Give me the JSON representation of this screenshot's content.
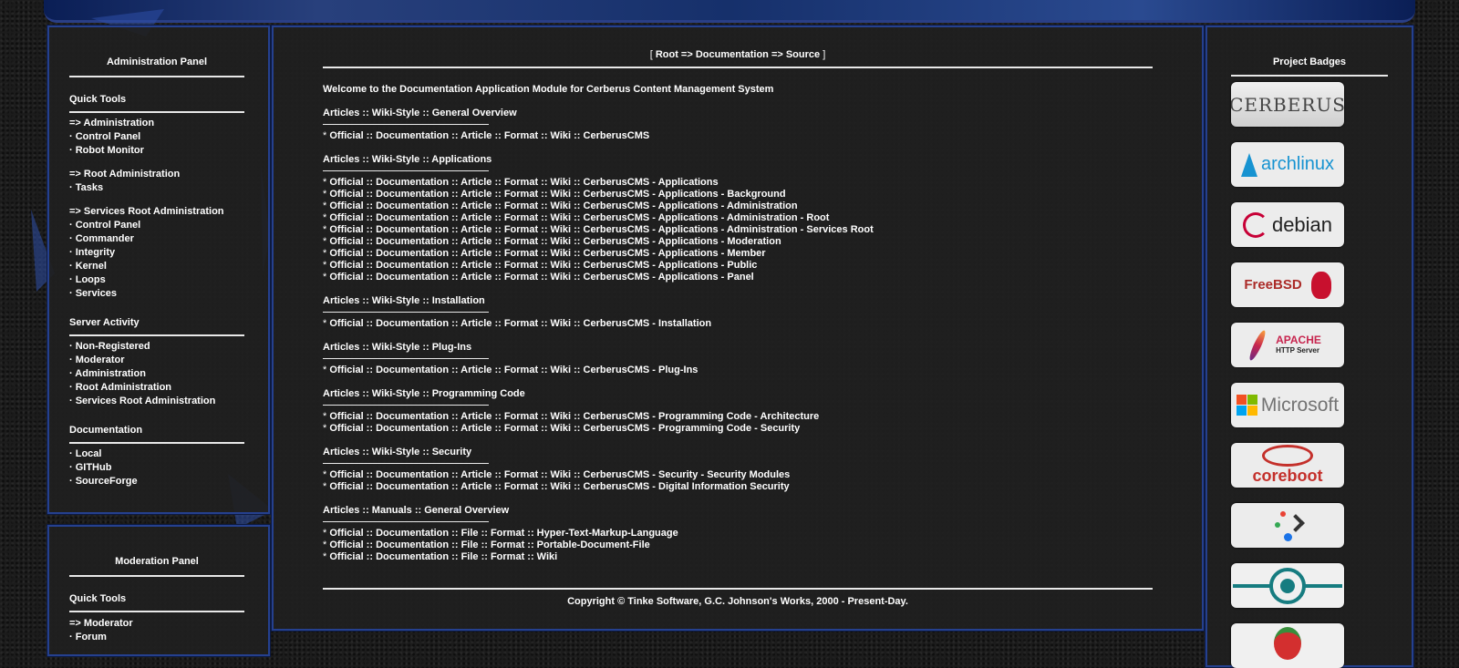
{
  "admin_panel": {
    "title": "Administration Panel",
    "sections": [
      {
        "header": "Quick Tools",
        "items": [
          "=> Administration",
          "· Control Panel",
          "· Robot Monitor",
          "",
          "=> Root Administration",
          "· Tasks",
          "",
          "=> Services Root Administration",
          "· Control Panel",
          "· Commander",
          "· Integrity",
          "· Kernel",
          "· Loops",
          "· Services"
        ]
      },
      {
        "header": "Server Activity",
        "items": [
          "· Non-Registered",
          "· Moderator",
          "· Administration",
          "· Root Administration",
          "· Services Root Administration"
        ]
      },
      {
        "header": "Documentation",
        "items": [
          "· Local",
          "· GITHub",
          "· SourceForge"
        ]
      }
    ]
  },
  "moderation_panel": {
    "title": "Moderation Panel",
    "header": "Quick Tools",
    "items": [
      "=> Moderator",
      "· Forum"
    ]
  },
  "main": {
    "breadcrumb": {
      "open": "[ ",
      "path": "Root => Documentation => Source",
      "close": " ]"
    },
    "welcome": "Welcome to the Documentation Application Module for Cerberus Content Management System",
    "sections": [
      {
        "header": "Articles :: Wiki-Style :: General Overview",
        "items": [
          "Official :: Documentation :: Article :: Format :: Wiki :: CerberusCMS"
        ]
      },
      {
        "header": "Articles :: Wiki-Style :: Applications",
        "items": [
          "Official :: Documentation :: Article :: Format :: Wiki :: CerberusCMS - Applications",
          "Official :: Documentation :: Article :: Format :: Wiki :: CerberusCMS - Applications - Background",
          "Official :: Documentation :: Article :: Format :: Wiki :: CerberusCMS - Applications - Administration",
          "Official :: Documentation :: Article :: Format :: Wiki :: CerberusCMS - Applications - Administration - Root",
          "Official :: Documentation :: Article :: Format :: Wiki :: CerberusCMS - Applications - Administration - Services Root",
          "Official :: Documentation :: Article :: Format :: Wiki :: CerberusCMS - Applications - Moderation",
          "Official :: Documentation :: Article :: Format :: Wiki :: CerberusCMS - Applications - Member",
          "Official :: Documentation :: Article :: Format :: Wiki :: CerberusCMS - Applications - Public",
          "Official :: Documentation :: Article :: Format :: Wiki :: CerberusCMS - Applications - Panel"
        ]
      },
      {
        "header": "Articles :: Wiki-Style :: Installation",
        "items": [
          "Official :: Documentation :: Article :: Format :: Wiki :: CerberusCMS - Installation"
        ]
      },
      {
        "header": "Articles :: Wiki-Style :: Plug-Ins",
        "items": [
          "Official :: Documentation :: Article :: Format :: Wiki :: CerberusCMS - Plug-Ins"
        ]
      },
      {
        "header": "Articles :: Wiki-Style :: Programming Code",
        "items": [
          "Official :: Documentation :: Article :: Format :: Wiki :: CerberusCMS - Programming Code - Architecture",
          "Official :: Documentation :: Article :: Format :: Wiki :: CerberusCMS - Programming Code - Security"
        ]
      },
      {
        "header": "Articles :: Wiki-Style :: Security",
        "items": [
          "Official :: Documentation :: Article :: Format :: Wiki :: CerberusCMS - Security - Security Modules",
          "Official :: Documentation :: Article :: Format :: Wiki :: CerberusCMS - Digital Information Security"
        ]
      },
      {
        "header": "Articles :: Manuals :: General Overview",
        "items": [
          "Official :: Documentation :: File :: Format :: Hyper-Text-Markup-Language",
          "Official :: Documentation :: File :: Format :: Portable-Document-File",
          "Official :: Documentation :: File :: Format :: Wiki"
        ]
      }
    ],
    "bullet": "* ",
    "copyright": "Copyright © Tinke Software, G.C. Johnson's Works, 2000 - Present-Day."
  },
  "badges": {
    "title": "Project Badges",
    "items": [
      {
        "name": "cerberus",
        "text": "CERBERUS"
      },
      {
        "name": "archlinux",
        "text": "archlinux"
      },
      {
        "name": "debian",
        "text": "debian"
      },
      {
        "name": "freebsd",
        "text": "FreeBSD"
      },
      {
        "name": "apache",
        "text": "APACHE",
        "sub": "HTTP Server"
      },
      {
        "name": "microsoft",
        "text": "Microsoft"
      },
      {
        "name": "coreboot",
        "text": "coreboot"
      },
      {
        "name": "terminal",
        "text": ""
      },
      {
        "name": "lineageos",
        "text": ""
      },
      {
        "name": "tomato",
        "text": ""
      }
    ]
  },
  "colors": {
    "border": "#25408e",
    "panel_bg": "#202020",
    "text": "#ffffff"
  }
}
